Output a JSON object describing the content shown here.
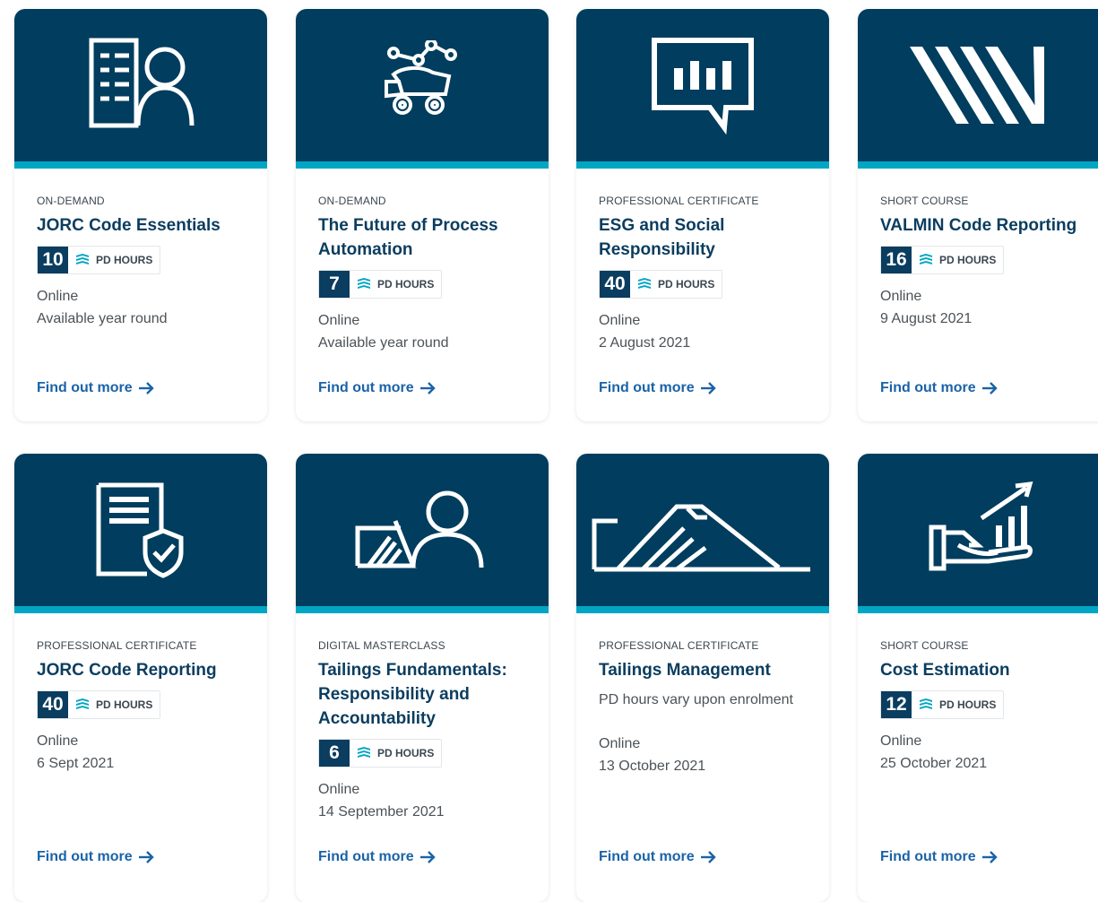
{
  "pd_label": "PD HOURS",
  "link_label": "Find out more",
  "cards": [
    {
      "category": "ON-DEMAND",
      "title": "JORC Code Essentials",
      "pd_hours": "10",
      "mode": "Online",
      "date": "Available year round",
      "icon": "document-person-icon"
    },
    {
      "category": "ON-DEMAND",
      "title": "The Future of Process Automation",
      "pd_hours": "7",
      "mode": "Online",
      "date": "Available year round",
      "icon": "dump-truck-chart-icon"
    },
    {
      "category": "PROFESSIONAL CERTIFICATE",
      "title": "ESG and Social Responsibility",
      "pd_hours": "40",
      "mode": "Online",
      "date": "2 August 2021",
      "icon": "chat-bar-chart-icon"
    },
    {
      "category": "SHORT COURSE",
      "title": "VALMIN Code Reporting",
      "pd_hours": "16",
      "mode": "Online",
      "date": "9 August 2021",
      "icon": "diagonal-stripes-icon"
    },
    {
      "category": "PROFESSIONAL CERTIFICATE",
      "title": "JORC Code Reporting",
      "pd_hours": "40",
      "mode": "Online",
      "date": "6 Sept 2021",
      "icon": "document-shield-icon"
    },
    {
      "category": "DIGITAL MASTERCLASS",
      "title": "Tailings Fundamentals: Responsibility and Accountability",
      "pd_hours": "6",
      "mode": "Online",
      "date": "14 September 2021",
      "icon": "tailings-dam-person-icon"
    },
    {
      "category": "PROFESSIONAL CERTIFICATE",
      "title": "Tailings Management",
      "pd_note": "PD hours vary upon enrolment",
      "mode": "Online",
      "date": "13 October 2021",
      "icon": "tailings-dam-icon"
    },
    {
      "category": "SHORT COURSE",
      "title": "Cost Estimation",
      "pd_hours": "12",
      "mode": "Online",
      "date": "25 October 2021",
      "icon": "hand-growth-chart-icon"
    }
  ],
  "colors": {
    "hero": "#003d5e",
    "hero_stripe": "#00a6c4",
    "title": "#0a3d5f",
    "link": "#1a63a8"
  }
}
